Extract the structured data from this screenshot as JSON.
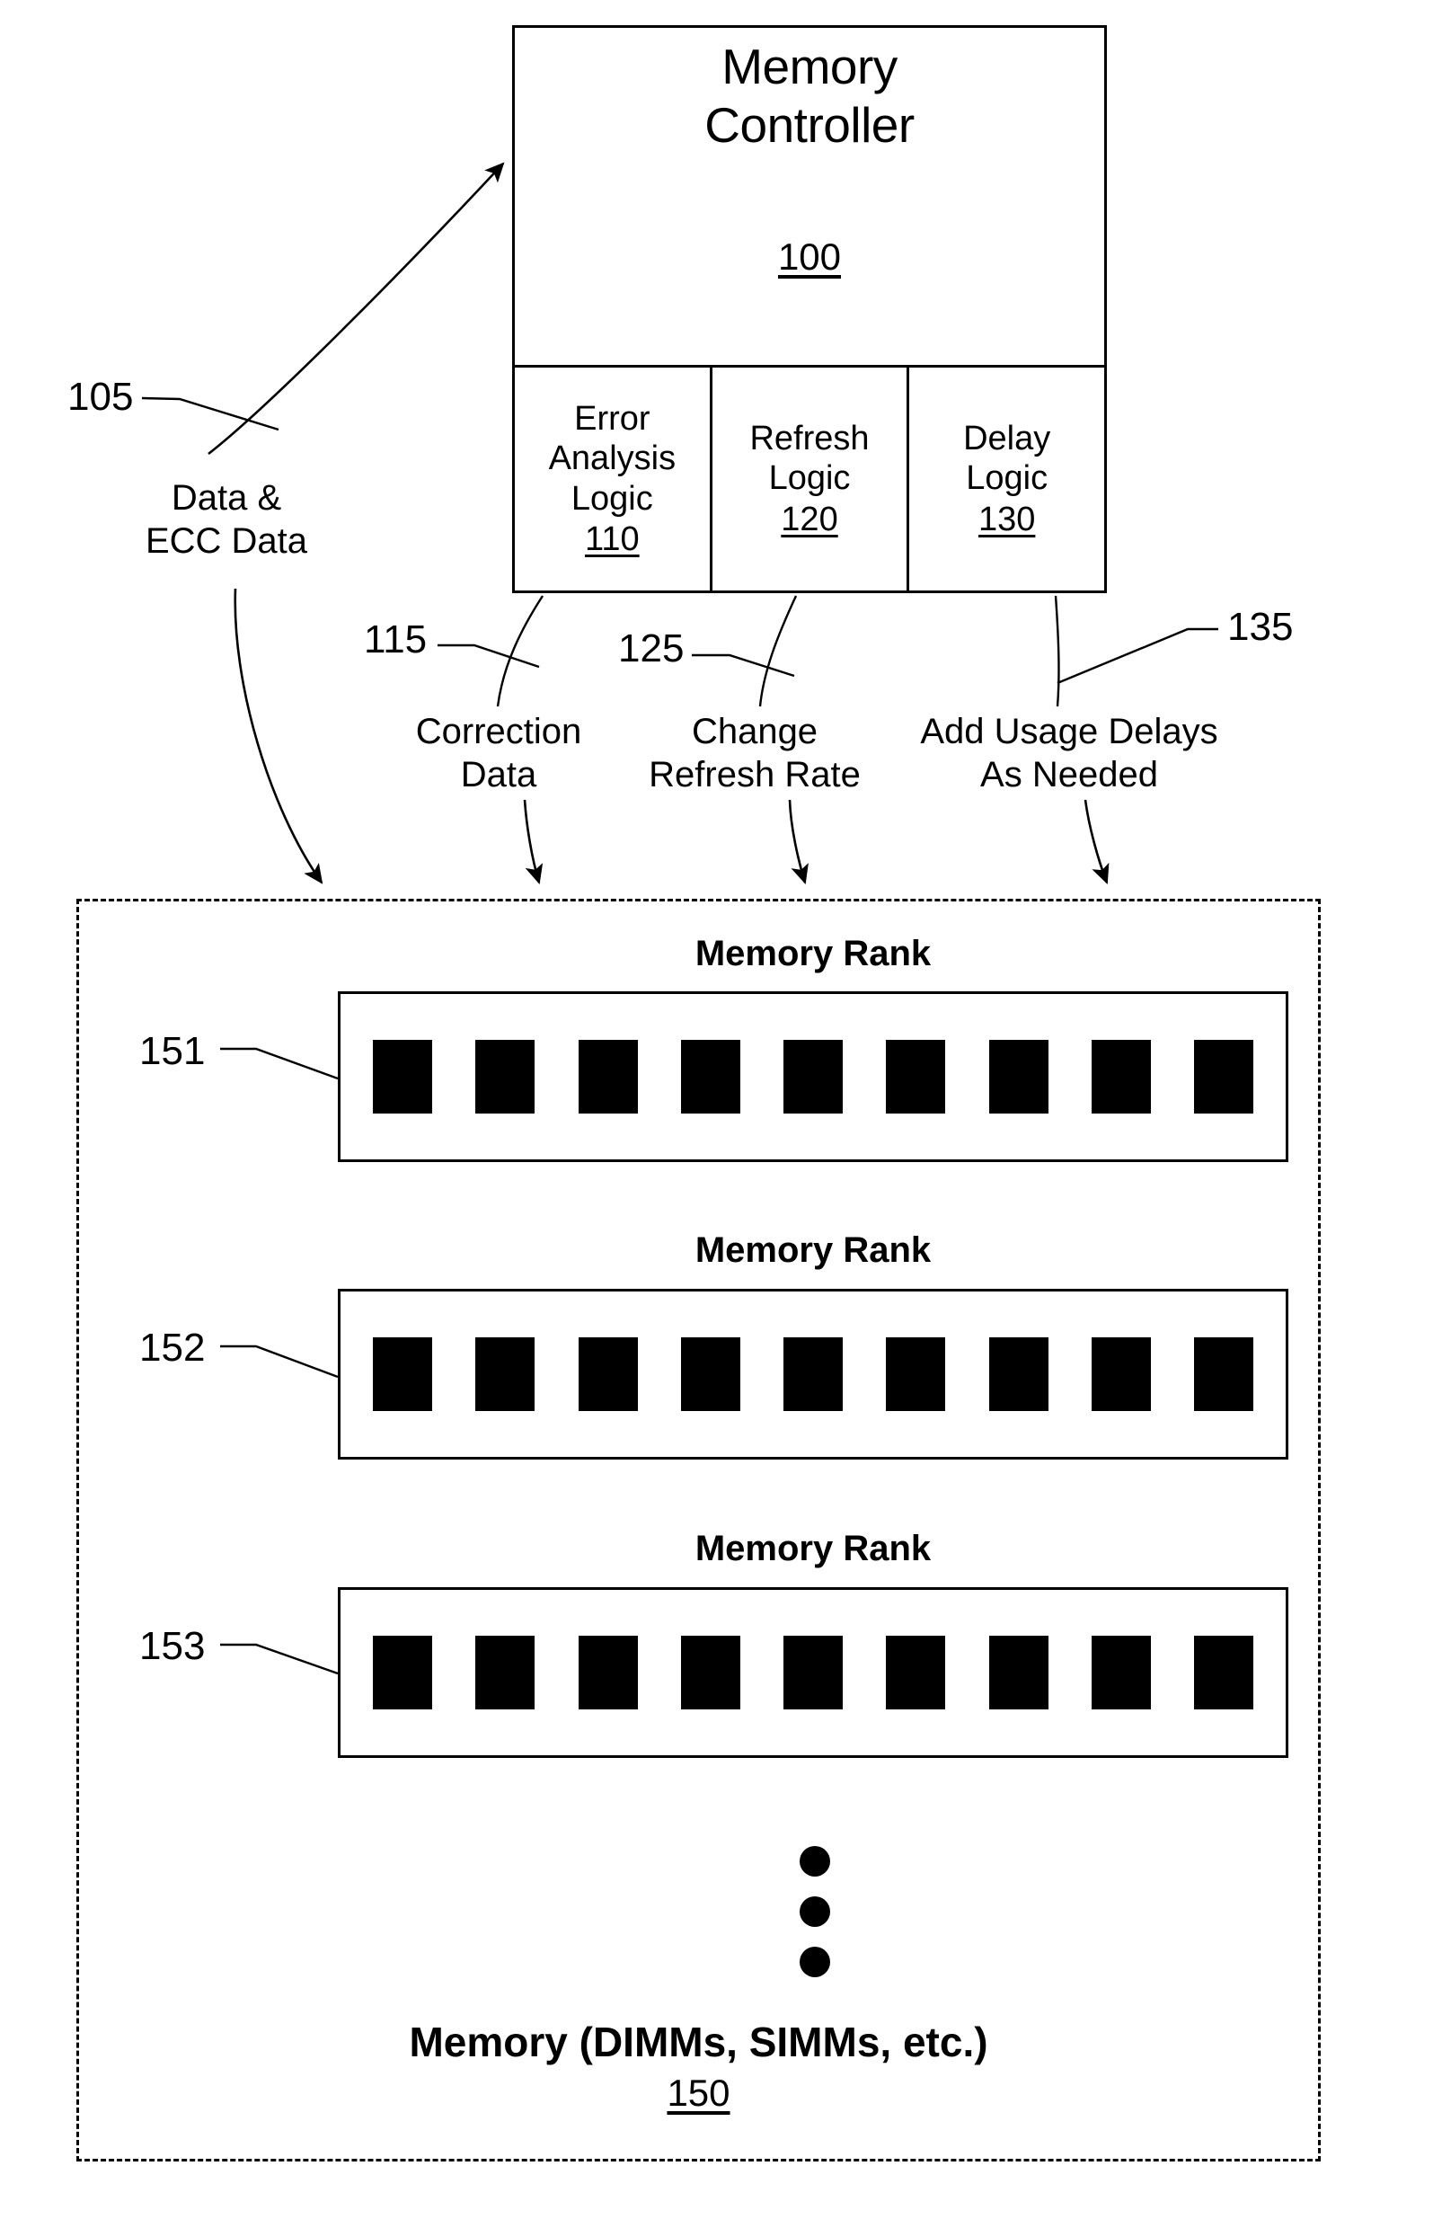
{
  "figure": {
    "controller": {
      "title_line1": "Memory",
      "title_line2": "Controller",
      "numeral": "100",
      "sub_blocks": [
        {
          "line1": "Error",
          "line2": "Analysis",
          "line3": "Logic",
          "numeral": "110"
        },
        {
          "line1": "Refresh",
          "line2": "Logic",
          "line3": "",
          "numeral": "120"
        },
        {
          "line1": "Delay",
          "line2": "Logic",
          "line3": "",
          "numeral": "130"
        }
      ]
    },
    "flows": [
      {
        "numeral": "105",
        "line1": "Data &",
        "line2": "ECC Data"
      },
      {
        "numeral": "115",
        "line1": "Correction",
        "line2": "Data"
      },
      {
        "numeral": "125",
        "line1": "Change",
        "line2": "Refresh Rate"
      },
      {
        "numeral": "135",
        "line1": "Add Usage Delays",
        "line2": "As Needed"
      }
    ],
    "memory": {
      "caption": "Memory (DIMMs, SIMMs, etc.)",
      "numeral": "150",
      "ranks": [
        {
          "title": "Memory Rank",
          "numeral": "151",
          "chip_count": 9
        },
        {
          "title": "Memory Rank",
          "numeral": "152",
          "chip_count": 9
        },
        {
          "title": "Memory Rank",
          "numeral": "153",
          "chip_count": 9
        }
      ],
      "continuation_indicator": "vertical-ellipsis"
    },
    "colors": {
      "ink": "#000000",
      "paper": "#ffffff"
    }
  }
}
